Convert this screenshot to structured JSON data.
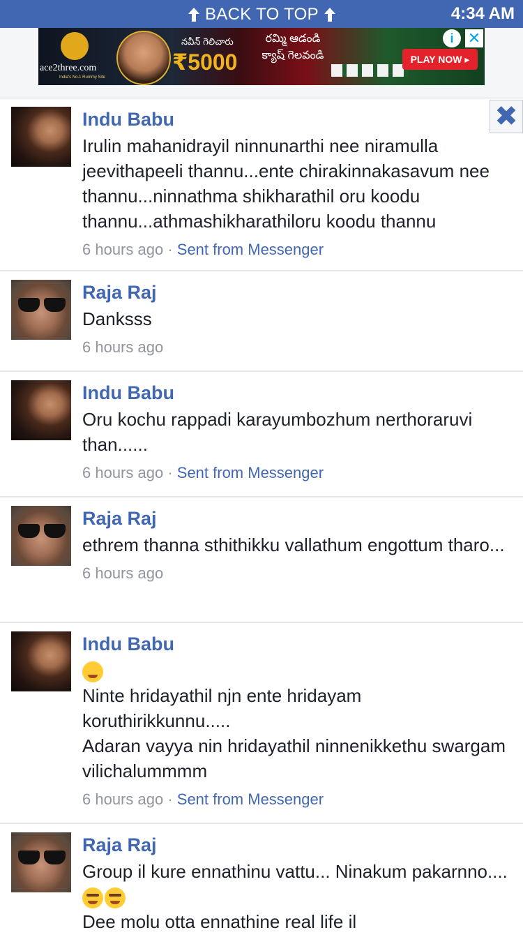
{
  "status_bar": {
    "time": "4:34 AM"
  },
  "topbar": {
    "back_to_top": "BACK TO TOP"
  },
  "ad": {
    "brand": "ace2three.com",
    "brand_tagline": "India's No.1 Rummy Site",
    "telugu_left": "నవీన్ గెలిచారు",
    "amount": "₹5000",
    "telugu_right": "రమ్మి ఆడండి క్యాష్ గెలవండి",
    "play_now": "PLAY NOW ▸",
    "info_icon": "info-icon",
    "close_icon": "close-icon"
  },
  "comments": [
    {
      "author": "Indu Babu",
      "lines": [
        "Irulin mahanidrayil ninnunarthi nee niramulla jeevithapeeli thannu...ente chirakinnakasavum nee thannu...ninnathma shikharathil oru koodu thannu...athmashikharathiloru koodu thannu"
      ],
      "time": "6 hours ago",
      "source": "Sent from Messenger"
    },
    {
      "author": "Raja Raj",
      "lines": [
        "Danksss"
      ],
      "time": "6 hours ago"
    },
    {
      "author": "Indu Babu",
      "lines": [
        "Oru kochu rappadi karayumbozhum nerthoraruvi than......"
      ],
      "time": "6 hours ago",
      "source": "Sent from Messenger"
    },
    {
      "author": "Raja Raj",
      "lines": [
        "ethrem thanna sthithikku vallathum engottum tharo..."
      ],
      "time": "6 hours ago"
    },
    {
      "author": "Indu Babu",
      "lines": [
        "Ninte hridayathil njn ente hridayam koruthirikkunnu.....",
        "Adaran vayya nin hridayathil ninnenikkethu swargam vilichalummmm"
      ],
      "time": "6 hours ago",
      "source": "Sent from Messenger"
    },
    {
      "author": "Raja Raj",
      "lines": [
        "Group il kure ennathinu vattu... Ninakum pakarnno....",
        "Dee molu otta ennathine real life il"
      ],
      "time": ""
    }
  ],
  "separator": " · "
}
